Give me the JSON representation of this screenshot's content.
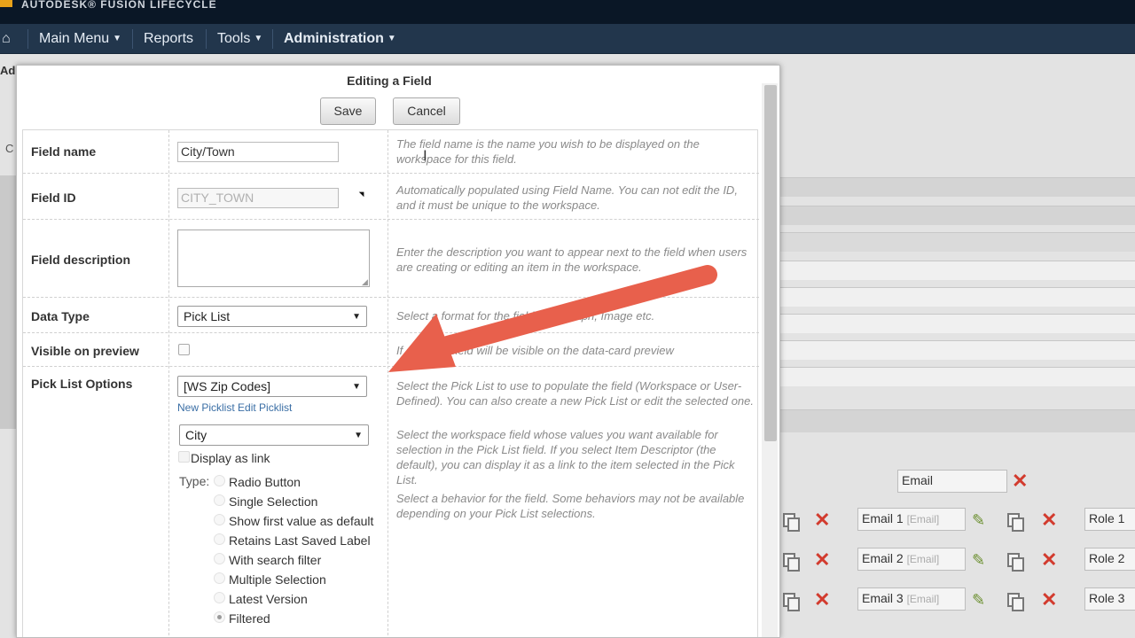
{
  "brand": {
    "text": "AUTODESK® FUSION LIFECYCLE"
  },
  "nav": {
    "home_icon": "home-icon",
    "items": [
      "Main Menu",
      "Reports",
      "Tools",
      "Administration"
    ]
  },
  "background": {
    "crumb": "Ad",
    "side_c": "C",
    "email_field": "Email",
    "rows": [
      {
        "email": "Email 1",
        "email_hint": "[Email]",
        "role": "Role 1"
      },
      {
        "email": "Email 2",
        "email_hint": "[Email]",
        "role": "Role 2"
      },
      {
        "email": "Email 3",
        "email_hint": "[Email]",
        "role": "Role 3"
      }
    ]
  },
  "dialog": {
    "title": "Editing a Field",
    "save_label": "Save",
    "cancel_label": "Cancel",
    "fields": {
      "field_name": {
        "label": "Field name",
        "value": "City/Town",
        "help": "The field name is the name you wish to be displayed on the workspace for this field."
      },
      "field_id": {
        "label": "Field ID",
        "value": "CITY_TOWN",
        "help": "Automatically populated using Field Name. You can not edit the ID, and it must be unique to the workspace."
      },
      "field_description": {
        "label": "Field description",
        "value": "",
        "help": "Enter the description you want to appear next to the field when users are creating or editing an item in the workspace."
      },
      "data_type": {
        "label": "Data Type",
        "value": "Pick List",
        "help": "Select a format for the field. Paragraph, Image etc."
      },
      "visible_on_preview": {
        "label": "Visible on preview",
        "help": "If checked field will be visible on the data-card preview"
      },
      "pick_list_options": {
        "label": "Pick List Options",
        "picklist_value": "[WS Zip Codes]",
        "new_picklist": "New Picklist",
        "edit_picklist": "Edit Picklist",
        "help_1": "Select the Pick List to use to populate the field (Workspace or User-Defined). You can also create a new Pick List or edit the selected one.",
        "field_value": "City",
        "help_2": "Select the workspace field whose values you want available for selection in the Pick List field. If you select Item Descriptor (the default), you can display it as a link to the item selected in the Pick List.",
        "display_as_link": "Display as link",
        "type_label": "Type:",
        "types": [
          "Radio Button",
          "Single Selection",
          "Show first value as default",
          "Retains Last Saved Label",
          "With search filter",
          "Multiple Selection",
          "Latest Version",
          "Filtered"
        ],
        "selected_type": "Filtered",
        "help_3": "Select a behavior for the field. Some behaviors may not be available depending on your Pick List selections."
      }
    }
  },
  "colors": {
    "nav_bg": "#22364c",
    "brand_bg": "#0a1726",
    "annotation_arrow": "#e8604c",
    "delete_red": "#d23b2e"
  }
}
